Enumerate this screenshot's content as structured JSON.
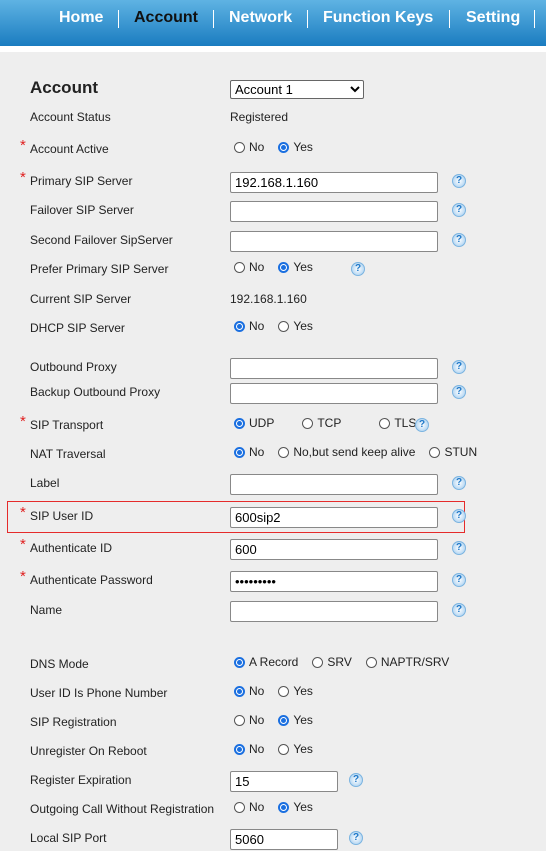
{
  "nav": {
    "items": [
      {
        "label": "Home",
        "active": false
      },
      {
        "label": "Account",
        "active": true
      },
      {
        "label": "Network",
        "active": false
      },
      {
        "label": "Function Keys",
        "active": false
      },
      {
        "label": "Setting",
        "active": false
      }
    ]
  },
  "account": {
    "title": "Account",
    "selected": "Account 1"
  },
  "rows": [
    {
      "label": "Account Status",
      "type": "text",
      "value": "Registered"
    },
    {
      "label": "Account Active",
      "required": true,
      "type": "radio",
      "options": [
        "No",
        "Yes"
      ],
      "selected": 1
    },
    {
      "label": "Primary SIP Server",
      "required": true,
      "type": "input",
      "value": "192.168.1.160",
      "help": true
    },
    {
      "label": "Failover SIP Server",
      "type": "input",
      "value": "",
      "help": true
    },
    {
      "label": "Second Failover SipServer",
      "type": "input",
      "value": "",
      "help": true
    },
    {
      "label": "Prefer Primary SIP Server",
      "type": "radio",
      "options": [
        "No",
        "Yes"
      ],
      "selected": 1,
      "help": true
    },
    {
      "label": "Current SIP Server",
      "type": "text",
      "value": "192.168.1.160"
    },
    {
      "label": "DHCP SIP Server",
      "type": "radio",
      "options": [
        "No",
        "Yes"
      ],
      "selected": 0
    },
    {
      "label": "Outbound Proxy",
      "type": "input",
      "value": "",
      "help": true
    },
    {
      "label": "Backup Outbound Proxy",
      "type": "input",
      "value": "",
      "help": true
    },
    {
      "label": "SIP Transport",
      "required": true,
      "type": "radio",
      "options": [
        "UDP",
        "TCP",
        "TLS"
      ],
      "selected": 0,
      "help": true
    },
    {
      "label": "NAT Traversal",
      "type": "radio",
      "options": [
        "No",
        "No,but send keep alive",
        "STUN"
      ],
      "selected": 0
    },
    {
      "label": "Label",
      "type": "input",
      "value": "",
      "help": true
    },
    {
      "label": "SIP User ID",
      "required": true,
      "type": "input",
      "value": "600sip2",
      "help": true,
      "highlighted": true
    },
    {
      "label": "Authenticate ID",
      "required": true,
      "type": "input",
      "value": "600",
      "help": true
    },
    {
      "label": "Authenticate Password",
      "required": true,
      "type": "password",
      "value": "•••••••••",
      "help": true
    },
    {
      "label": "Name",
      "type": "input",
      "value": "",
      "help": true
    },
    {
      "label": "DNS Mode",
      "type": "radio",
      "options": [
        "A Record",
        "SRV",
        "NAPTR/SRV"
      ],
      "selected": 0
    },
    {
      "label": "User ID Is Phone Number",
      "type": "radio",
      "options": [
        "No",
        "Yes"
      ],
      "selected": 0
    },
    {
      "label": "SIP Registration",
      "type": "radio",
      "options": [
        "No",
        "Yes"
      ],
      "selected": 1
    },
    {
      "label": "Unregister On Reboot",
      "type": "radio",
      "options": [
        "No",
        "Yes"
      ],
      "selected": 0
    },
    {
      "label": "Register Expiration",
      "type": "short",
      "value": "15",
      "help": true
    },
    {
      "label": "Outgoing Call Without Registration",
      "type": "radio",
      "options": [
        "No",
        "Yes"
      ],
      "selected": 1
    },
    {
      "label": "Local SIP Port",
      "type": "short",
      "value": "5060",
      "help": true
    }
  ],
  "help_glyph": "?",
  "colors": {
    "nav_top": "#5fb3e3",
    "nav_bottom": "#1a7cc0",
    "required": "#e02020",
    "highlight": "#e52b2b",
    "radio": "#1a6fe0"
  }
}
